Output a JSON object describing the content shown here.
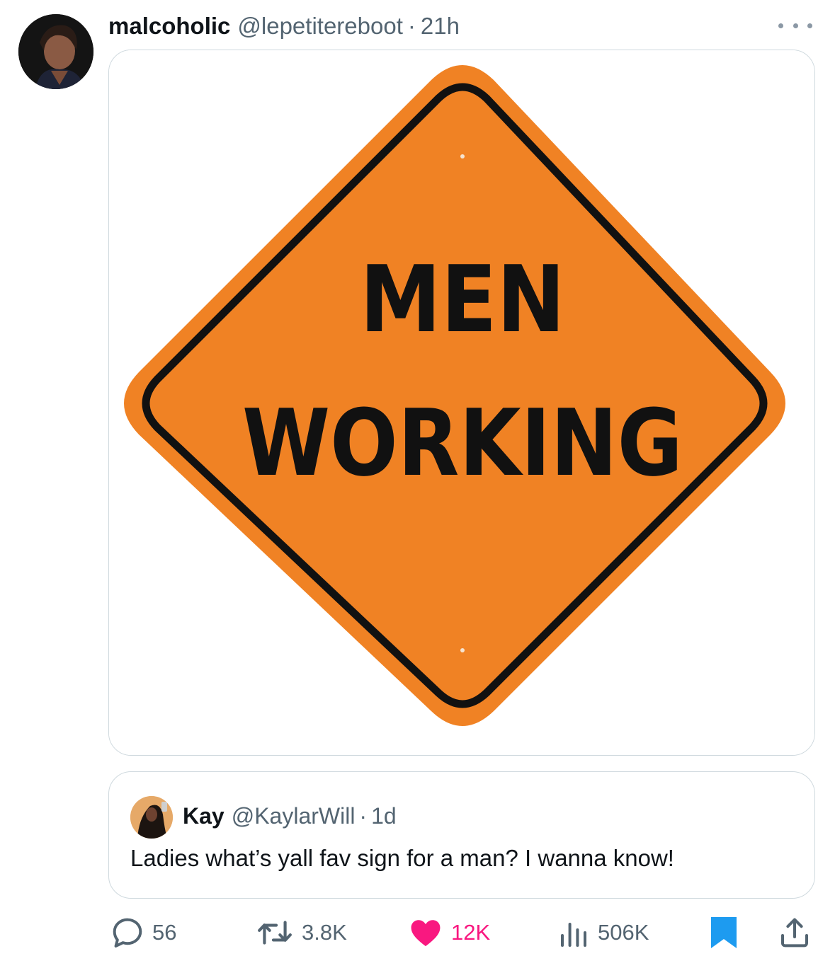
{
  "author": {
    "display_name": "malcoholic",
    "handle": "@lepetitereboot",
    "separator": "·",
    "time": "21h"
  },
  "media": {
    "sign_line_1": "MEN",
    "sign_line_2": "WORKING",
    "sign_color": "#f08224"
  },
  "quoted_tweet": {
    "display_name": "Kay",
    "handle": "@KaylarWill",
    "separator": "·",
    "time": "1d",
    "text": "Ladies what’s yall fav sign for a man? I wanna know!"
  },
  "actions": {
    "replies": "56",
    "retweets": "3.8K",
    "likes": "12K",
    "views": "506K",
    "like_color": "#f91880",
    "bookmark_color": "#1d9bf0",
    "icons": [
      "reply-icon",
      "retweet-icon",
      "heart-icon",
      "views-icon",
      "bookmark-icon",
      "share-icon"
    ]
  }
}
